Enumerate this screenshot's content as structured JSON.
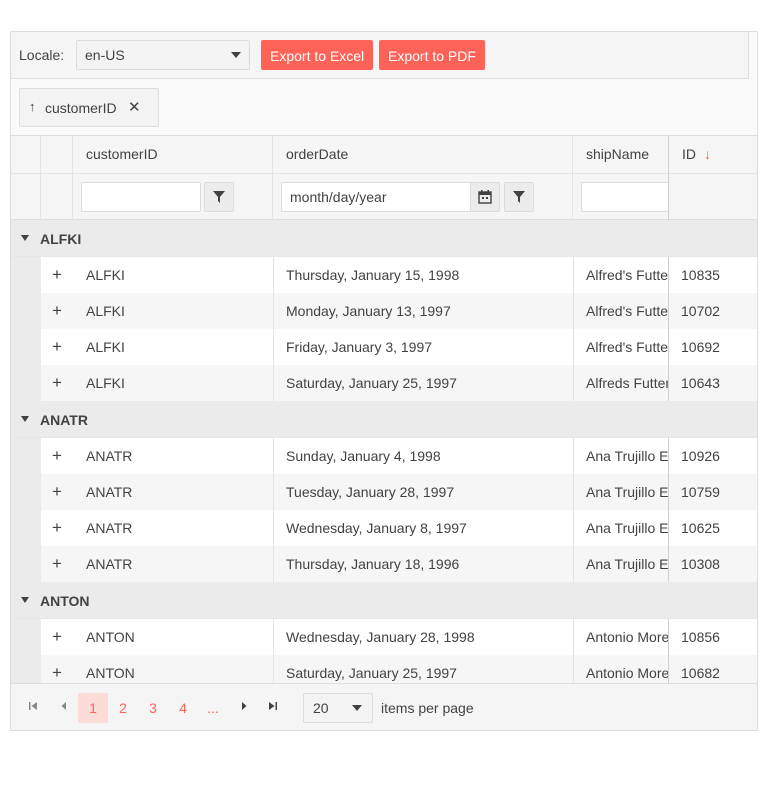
{
  "toolbar": {
    "locale_label": "Locale:",
    "locale_value": "en-US",
    "export_excel": "Export to Excel",
    "export_pdf": "Export to PDF"
  },
  "group_chip": {
    "arrow": "↑",
    "label": "customerID",
    "close": "✕"
  },
  "columns": {
    "customerID": "customerID",
    "orderDate": "orderDate",
    "shipName": "shipName",
    "id": "ID",
    "id_sort": "↓"
  },
  "filters": {
    "date_placeholder": "month/day/year"
  },
  "groups": [
    {
      "name": "ALFKI",
      "rows": [
        {
          "customerID": "ALFKI",
          "orderDate": "Thursday, January 15, 1998",
          "shipName": "Alfred's Futterkiste",
          "id": "10835"
        },
        {
          "customerID": "ALFKI",
          "orderDate": "Monday, January 13, 1997",
          "shipName": "Alfred's Futterkiste",
          "id": "10702"
        },
        {
          "customerID": "ALFKI",
          "orderDate": "Friday, January 3, 1997",
          "shipName": "Alfred's Futterkiste",
          "id": "10692"
        },
        {
          "customerID": "ALFKI",
          "orderDate": "Saturday, January 25, 1997",
          "shipName": "Alfreds Futterkiste",
          "id": "10643"
        }
      ]
    },
    {
      "name": "ANATR",
      "rows": [
        {
          "customerID": "ANATR",
          "orderDate": "Sunday, January 4, 1998",
          "shipName": "Ana Trujillo Emparedados y helados",
          "id": "10926"
        },
        {
          "customerID": "ANATR",
          "orderDate": "Tuesday, January 28, 1997",
          "shipName": "Ana Trujillo Emparedados y helados",
          "id": "10759"
        },
        {
          "customerID": "ANATR",
          "orderDate": "Wednesday, January 8, 1997",
          "shipName": "Ana Trujillo Emparedados y helados",
          "id": "10625"
        },
        {
          "customerID": "ANATR",
          "orderDate": "Thursday, January 18, 1996",
          "shipName": "Ana Trujillo Emparedados y helados",
          "id": "10308"
        }
      ]
    },
    {
      "name": "ANTON",
      "rows": [
        {
          "customerID": "ANTON",
          "orderDate": "Wednesday, January 28, 1998",
          "shipName": "Antonio Moreno Taquería",
          "id": "10856"
        },
        {
          "customerID": "ANTON",
          "orderDate": "Saturday, January 25, 1997",
          "shipName": "Antonio Moreno Taquería",
          "id": "10682"
        }
      ]
    }
  ],
  "pager": {
    "pages": [
      "1",
      "2",
      "3",
      "4",
      "..."
    ],
    "active_page": "1",
    "page_size": "20",
    "items_per_page": "items per page"
  },
  "icons": {
    "first": "first-page-icon",
    "prev": "prev-page-icon",
    "next": "next-page-icon",
    "last": "last-page-icon",
    "filter": "filter-icon",
    "calendar": "calendar-icon"
  },
  "colors": {
    "accent": "#ff6358",
    "active_page_bg": "#fbdcd9"
  }
}
